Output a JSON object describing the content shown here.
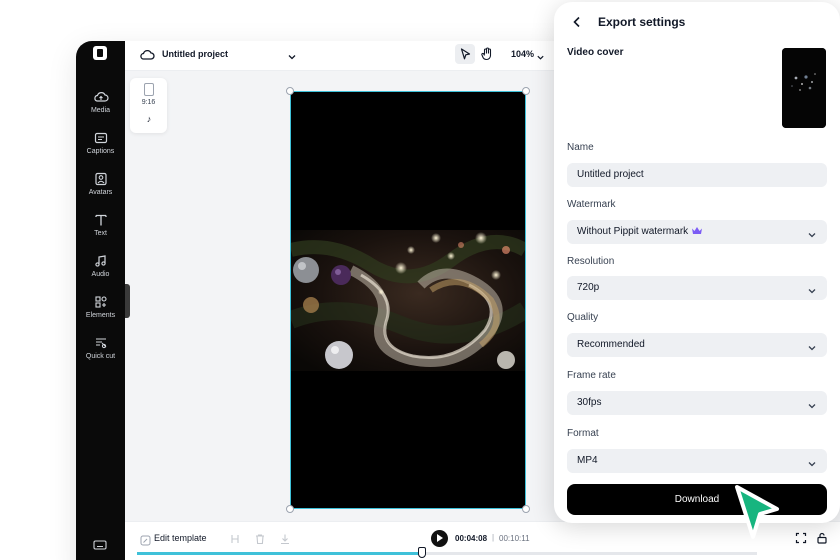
{
  "editor": {
    "project_title": "Untitled project",
    "zoom_level": "104%",
    "aspect_ratio": "9:16",
    "sidebar": [
      {
        "label": "Media",
        "icon": "cloud-upload-icon"
      },
      {
        "label": "Captions",
        "icon": "captions-icon"
      },
      {
        "label": "Avatars",
        "icon": "avatar-icon"
      },
      {
        "label": "Text",
        "icon": "text-icon"
      },
      {
        "label": "Audio",
        "icon": "music-note-icon"
      },
      {
        "label": "Elements",
        "icon": "elements-icon"
      },
      {
        "label": "Quick cut",
        "icon": "quick-cut-icon"
      }
    ],
    "bottom": {
      "edit_template": "Edit template",
      "current_time": "00:04:08",
      "separator": "|",
      "total_time": "00:10:11",
      "progress_fraction": 0.46
    }
  },
  "export": {
    "title": "Export settings",
    "video_cover_label": "Video cover",
    "fields": [
      {
        "label": "Name",
        "value": "Untitled project",
        "dropdown": false
      },
      {
        "label": "Watermark",
        "value": "Without Pippit watermark",
        "dropdown": true,
        "crown": true
      },
      {
        "label": "Resolution",
        "value": "720p",
        "dropdown": true
      },
      {
        "label": "Quality",
        "value": "Recommended",
        "dropdown": true
      },
      {
        "label": "Frame rate",
        "value": "30fps",
        "dropdown": true
      },
      {
        "label": "Format",
        "value": "MP4",
        "dropdown": true
      }
    ],
    "download_label": "Download"
  },
  "colors": {
    "accent_cyan": "#3fc1d9",
    "cursor_green": "#17b57f",
    "crown_purple": "#7c5cf5",
    "panel_bg": "#ffffff",
    "field_bg": "#eef0f3"
  }
}
